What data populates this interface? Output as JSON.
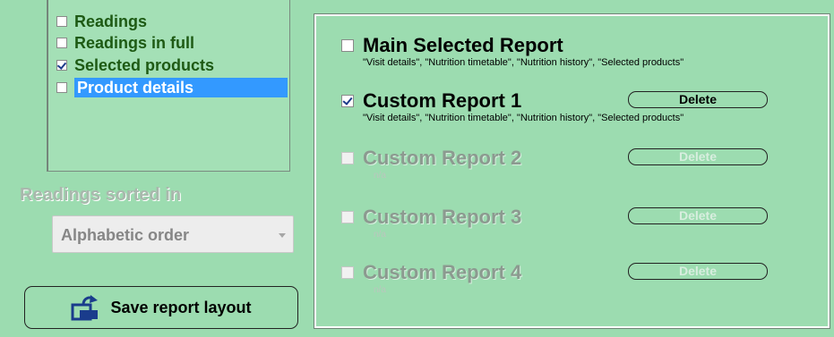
{
  "report_sections": [
    {
      "label": "Readings",
      "checked": false,
      "selected": false
    },
    {
      "label": "Readings in full",
      "checked": false,
      "selected": false
    },
    {
      "label": "Selected products",
      "checked": true,
      "selected": false
    },
    {
      "label": "Product details",
      "checked": false,
      "selected": true
    }
  ],
  "sorting": {
    "label": "Readings sorted in",
    "selected_option": "Alphabetic order"
  },
  "save_button_label": "Save report layout",
  "reports": [
    {
      "title": "Main Selected Report",
      "checked": false,
      "enabled": true,
      "description": "\"Visit details\", \"Nutrition timetable\", \"Nutrition history\", \"Selected products\"",
      "delete_label": null
    },
    {
      "title": "Custom Report 1",
      "checked": true,
      "enabled": true,
      "description": "\"Visit details\", \"Nutrition timetable\", \"Nutrition history\", \"Selected products\"",
      "delete_label": "Delete"
    },
    {
      "title": "Custom Report 2",
      "checked": false,
      "enabled": false,
      "description": "n/a",
      "delete_label": "Delete"
    },
    {
      "title": "Custom Report 3",
      "checked": false,
      "enabled": false,
      "description": "n/a",
      "delete_label": "Delete"
    },
    {
      "title": "Custom Report 4",
      "checked": false,
      "enabled": false,
      "description": "n/a",
      "delete_label": "Delete"
    }
  ]
}
